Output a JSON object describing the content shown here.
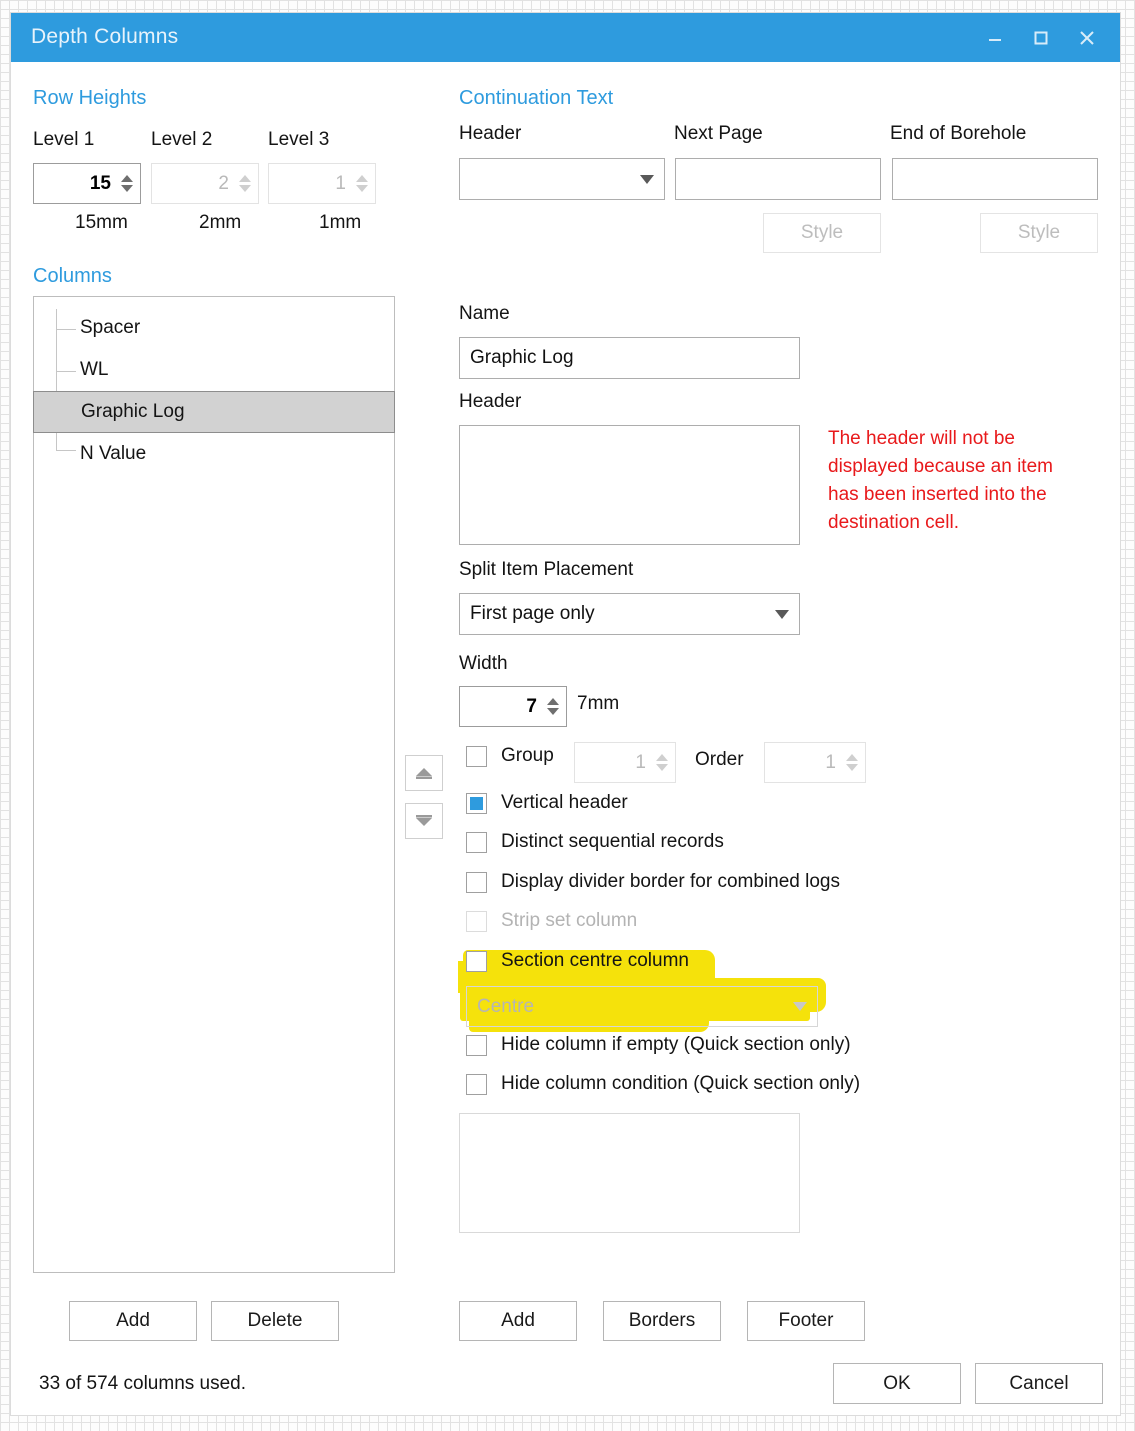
{
  "window": {
    "title": "Depth Columns",
    "titlebar_color": "#2e9bde",
    "minimize_icon": "minimize-icon",
    "maximize_icon": "maximize-icon",
    "close_icon": "close-icon"
  },
  "row_heights": {
    "section_title": "Row Heights",
    "levels": [
      {
        "label": "Level 1",
        "value": "15",
        "unit": "15mm",
        "enabled": true
      },
      {
        "label": "Level 2",
        "value": "2",
        "unit": "2mm",
        "enabled": false
      },
      {
        "label": "Level 3",
        "value": "1",
        "unit": "1mm",
        "enabled": false
      }
    ]
  },
  "columns_panel": {
    "section_title": "Columns",
    "items": [
      {
        "label": "Spacer",
        "selected": false
      },
      {
        "label": "WL",
        "selected": false
      },
      {
        "label": "Graphic Log",
        "selected": true
      },
      {
        "label": "N Value",
        "selected": false
      }
    ],
    "add_label": "Add",
    "delete_label": "Delete",
    "move_up_icon": "move-up-icon",
    "move_down_icon": "move-down-icon"
  },
  "continuation_text": {
    "section_title": "Continuation Text",
    "header_label": "Header",
    "header_value": "",
    "next_page_label": "Next Page",
    "next_page_value": "",
    "next_page_style_label": "Style",
    "end_of_borehole_label": "End of Borehole",
    "end_of_borehole_value": "",
    "end_of_borehole_style_label": "Style"
  },
  "details": {
    "name_label": "Name",
    "name_value": "Graphic Log",
    "header_label": "Header",
    "header_value": "",
    "header_warning": "The header will not be displayed because an item has been inserted into the destination cell.",
    "warning_color": "#e8191b",
    "split_item_placement_label": "Split Item Placement",
    "split_item_placement_value": "First page only",
    "width_label": "Width",
    "width_value": "7",
    "width_unit": "7mm",
    "group_label": "Group",
    "group_checked": false,
    "group_value": "1",
    "order_label": "Order",
    "order_value": "1",
    "checkboxes": [
      {
        "label": "Vertical header",
        "checked": true,
        "enabled": true
      },
      {
        "label": "Distinct sequential records",
        "checked": false,
        "enabled": true
      },
      {
        "label": "Display divider border for combined logs",
        "checked": false,
        "enabled": true
      },
      {
        "label": "Strip set column",
        "checked": false,
        "enabled": false
      },
      {
        "label": "Section centre column",
        "checked": false,
        "enabled": true,
        "highlighted": true
      },
      {
        "label": "Hide column if empty (Quick section only)",
        "checked": false,
        "enabled": true
      },
      {
        "label": "Hide column condition (Quick section only)",
        "checked": false,
        "enabled": true
      }
    ],
    "centre_dropdown_value": "Centre",
    "centre_dropdown_enabled": false,
    "condition_value": "",
    "add_label": "Add",
    "borders_label": "Borders",
    "footer_label": "Footer"
  },
  "footer": {
    "status": "33 of 574 columns used.",
    "ok_label": "OK",
    "cancel_label": "Cancel"
  },
  "annotation": {
    "highlight_color": "#f5e20b",
    "target": "Section centre column"
  }
}
